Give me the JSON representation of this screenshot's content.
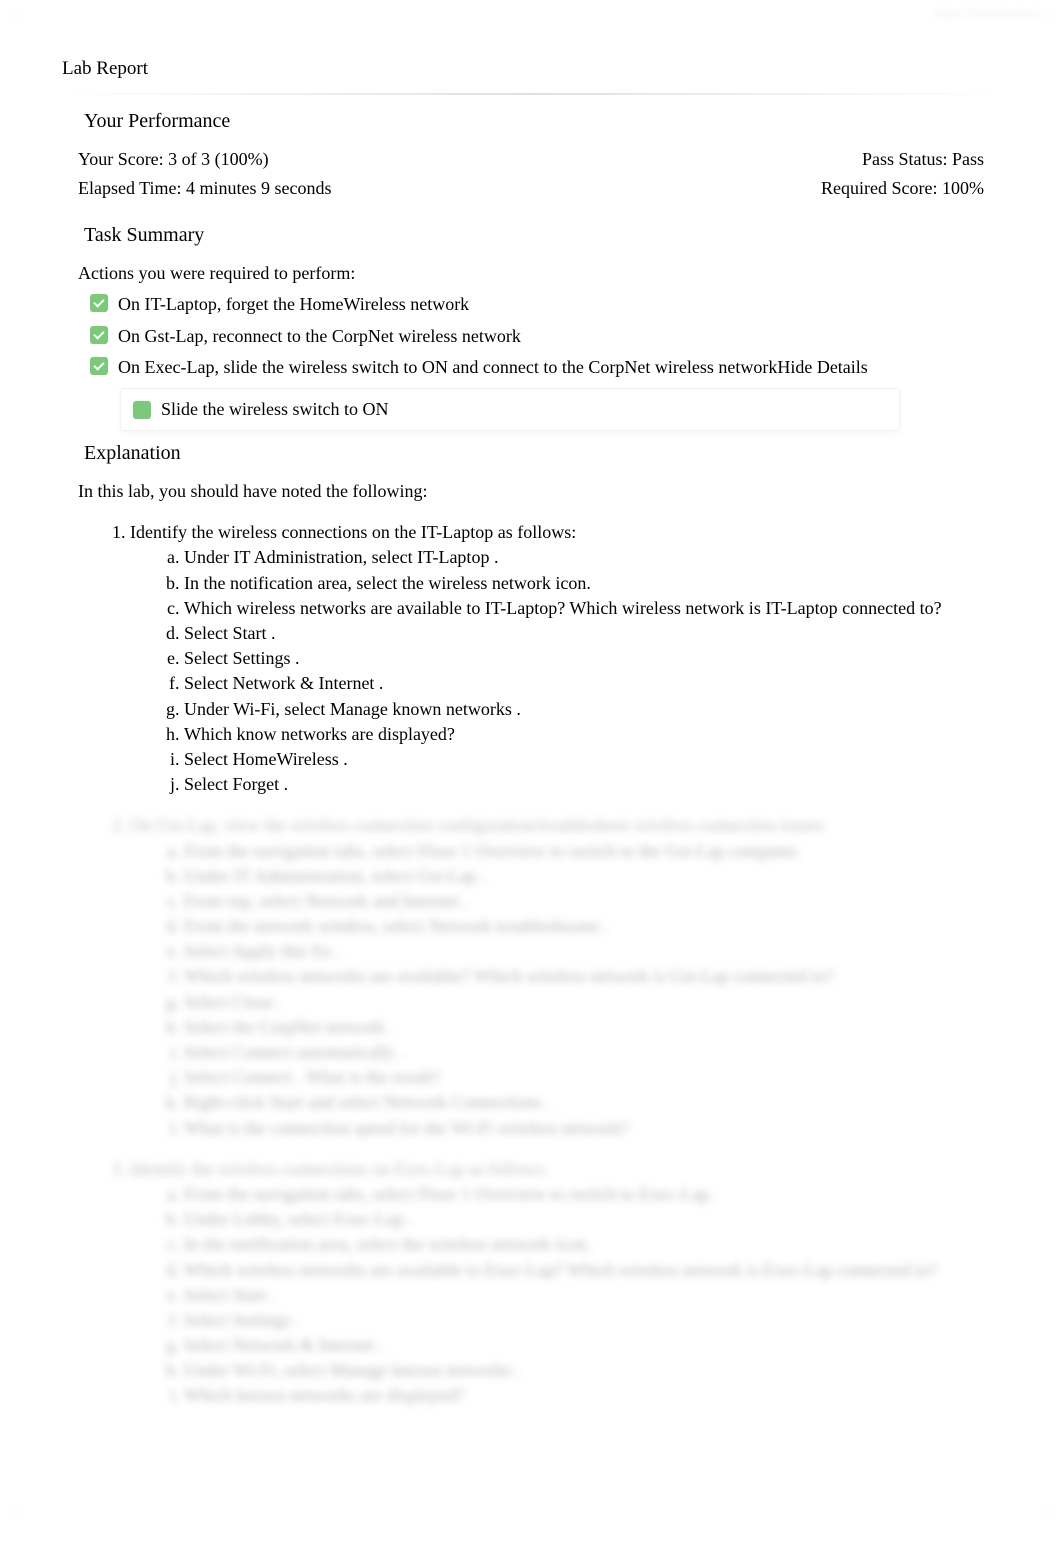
{
  "header": {
    "left_meta": "—",
    "right_meta": "https://labsimserver/…"
  },
  "report_title": "Lab Report",
  "performance": {
    "heading": "Your Performance",
    "score_label": "Your Score: 3 of 3 (100%)",
    "elapsed_label": "Elapsed Time: 4 minutes 9 seconds",
    "pass_status_label": "Pass Status: Pass",
    "required_score_label": "Required Score: 100%"
  },
  "task_summary": {
    "heading": "Task Summary",
    "intro": "Actions you were required to perform:",
    "tasks": [
      {
        "text": "On IT-Laptop, forget the HomeWireless network"
      },
      {
        "text": "On Gst-Lap, reconnect to the CorpNet wireless network"
      },
      {
        "text": "On Exec-Lap, slide the wireless switch to ON and connect to the CorpNet wireless network",
        "toggle": "Hide Details"
      }
    ],
    "detail_line": "Slide the wireless switch to ON"
  },
  "explanation": {
    "heading": "Explanation",
    "intro": "In this lab, you should have noted the following:",
    "steps": [
      {
        "title": "Identify the wireless connections on the IT-Laptop as follows:",
        "substeps": [
          "Under IT Administration, select IT-Laptop .",
          "In the notification area, select the wireless network  icon.",
          "Which wireless networks are available to IT-Laptop? Which wireless network is IT-Laptop connected to?",
          "Select Start .",
          "Select Settings .",
          "Select Network & Internet  .",
          "Under Wi-Fi, select Manage known networks  .",
          "Which know networks are displayed?",
          "Select HomeWireless .",
          "Select Forget ."
        ]
      },
      {
        "title": "On Gst-Lap, view the wireless connection configuration/troubleshoot wireless connection issues",
        "substeps": [
          "From the navigation tabs, select Floor 1 Overview to switch to the Gst-Lap computer.",
          "Under IT Administration, select Gst-Lap .",
          "From top, select Network and Internet .",
          "From the network window, select Network troubleshooter .",
          "Select Apply this fix .",
          "Which wireless networks are available? Which wireless network is Gst-Lap connected to?",
          "Select Close .",
          "Select the CorpNet network .",
          "Select Connect automatically .",
          "Select Connect . What is the result?",
          "Right-click Start and select Network Connections .",
          "What is the connection speed for the Wi-Fi wireless network?"
        ]
      },
      {
        "title": "Identify the wireless connections on Exec-Lap as follows:",
        "substeps": [
          "From the navigation tabs, select Floor 1 Overview to switch to Exec-Lap.",
          "Under Lobby, select Exec-Lap .",
          "In the notification area, select the wireless network  icon.",
          "Which wireless networks are available to Exec-Lap? Which wireless network is Exec-Lap connected to?",
          "Select Start .",
          "Select Settings .",
          "Select Network & Internet .",
          "Under Wi-Fi, select Manage known networks .",
          "Which known networks are displayed?"
        ]
      }
    ]
  },
  "footer": {
    "left": "…",
    "right": "…"
  }
}
